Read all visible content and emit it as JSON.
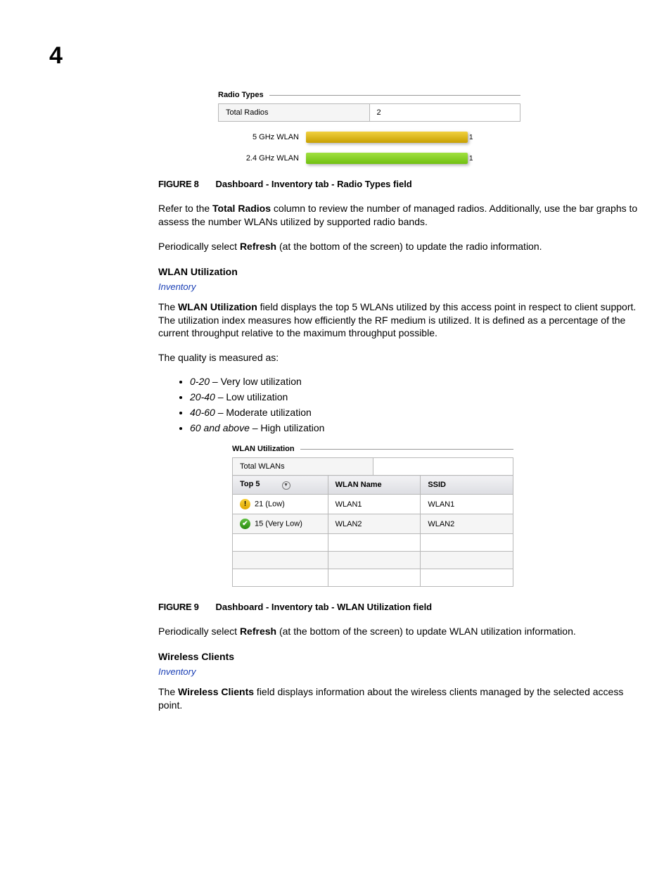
{
  "chapter_number": "4",
  "figure8": {
    "section_title": "Radio Types",
    "total_label": "Total Radios",
    "total_value": "2",
    "bars": [
      {
        "label": "5 GHz WLAN",
        "value": "1",
        "color": "yellow"
      },
      {
        "label": "2.4 GHz WLAN",
        "value": "1",
        "color": "green"
      }
    ],
    "caption_label": "FIGURE 8",
    "caption_text": "Dashboard - Inventory tab - Radio Types field"
  },
  "para1_a": "Refer to the ",
  "para1_bold": "Total Radios",
  "para1_b": " column to review the number of managed radios. Additionally, use the bar graphs to assess the number WLANs utilized by supported radio bands.",
  "para2_a": "Periodically select ",
  "para2_bold": "Refresh",
  "para2_b": " (at the bottom of the screen) to update the radio information.",
  "wlan_util_heading": "WLAN Utilization",
  "inventory_link": "Inventory",
  "para3_a": "The ",
  "para3_bold": "WLAN Utilization",
  "para3_b": " field displays the top 5 WLANs utilized by this access point in respect to client support. The utilization index measures how efficiently the RF medium is utilized. It is defined as a percentage of the current throughput relative to the maximum throughput possible.",
  "quality_intro": "The quality is measured as:",
  "quality_items": [
    {
      "range": "0-20",
      "desc": " – Very low utilization"
    },
    {
      "range": "20-40",
      "desc": " – Low utilization"
    },
    {
      "range": "40-60",
      "desc": " – Moderate utilization"
    },
    {
      "range": "60 and above",
      "desc": " – High utilization"
    }
  ],
  "figure9": {
    "section_title": "WLAN Utilization",
    "total_label": "Total WLANs",
    "headers": {
      "top5": "Top 5",
      "wlan": "WLAN Name",
      "ssid": "SSID"
    },
    "rows": [
      {
        "status": "warn",
        "value": "21 (Low)",
        "wlan": "WLAN1",
        "ssid": "WLAN1"
      },
      {
        "status": "ok",
        "value": "15 (Very Low)",
        "wlan": "WLAN2",
        "ssid": "WLAN2"
      }
    ],
    "caption_label": "FIGURE 9",
    "caption_text": "Dashboard - Inventory tab - WLAN Utilization field"
  },
  "para4_a": "Periodically select ",
  "para4_bold": "Refresh",
  "para4_b": " (at the bottom of the screen) to update WLAN utilization information.",
  "wireless_clients_heading": "Wireless Clients",
  "para5_a": "The ",
  "para5_bold": "Wireless Clients",
  "para5_b": " field displays information about the wireless clients managed by the selected access point.",
  "chart_data": [
    {
      "type": "bar",
      "title": "Radio Types",
      "categories": [
        "5 GHz WLAN",
        "2.4 GHz WLAN"
      ],
      "values": [
        1,
        1
      ],
      "xlabel": "",
      "ylabel": "",
      "ylim": [
        0,
        1
      ]
    },
    {
      "type": "table",
      "title": "WLAN Utilization",
      "columns": [
        "Top 5",
        "WLAN Name",
        "SSID"
      ],
      "rows": [
        [
          "21 (Low)",
          "WLAN1",
          "WLAN1"
        ],
        [
          "15 (Very Low)",
          "WLAN2",
          "WLAN2"
        ]
      ]
    }
  ]
}
